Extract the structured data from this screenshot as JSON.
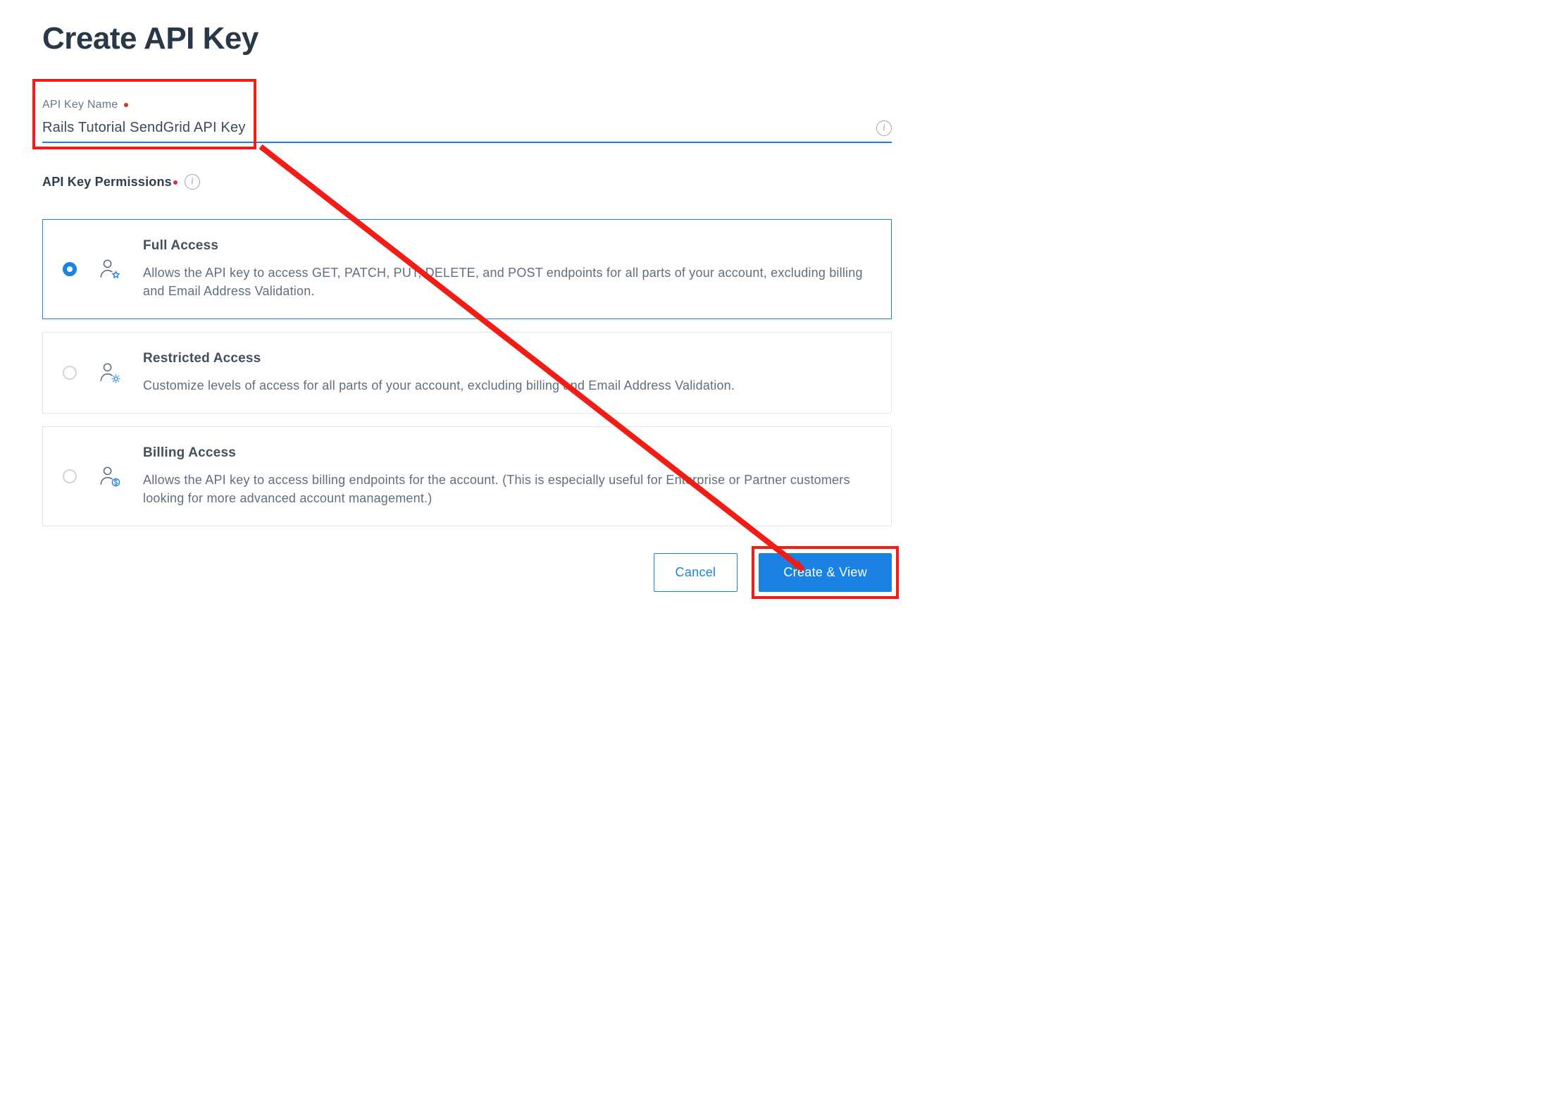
{
  "page_title": "Create API Key",
  "name_field": {
    "label": "API Key Name",
    "value": "Rails Tutorial SendGrid API Key"
  },
  "permissions_label": "API Key Permissions",
  "options": [
    {
      "id": "full",
      "title": "Full Access",
      "description": "Allows the API key to access GET, PATCH, PUT, DELETE, and POST endpoints for all parts of your account, excluding billing and Email Address Validation.",
      "selected": true,
      "icon": "user-star"
    },
    {
      "id": "restricted",
      "title": "Restricted Access",
      "description": "Customize levels of access for all parts of your account, excluding billing and Email Address Validation.",
      "selected": false,
      "icon": "user-gear"
    },
    {
      "id": "billing",
      "title": "Billing Access",
      "description": "Allows the API key to access billing endpoints for the account. (This is especially useful for Enterprise or Partner customers looking for more advanced account management.)",
      "selected": false,
      "icon": "user-dollar"
    }
  ],
  "actions": {
    "cancel": "Cancel",
    "create": "Create & View"
  },
  "colors": {
    "primary": "#1a82e2",
    "annotation": "#f01c15",
    "text_muted": "#5f6f80"
  }
}
